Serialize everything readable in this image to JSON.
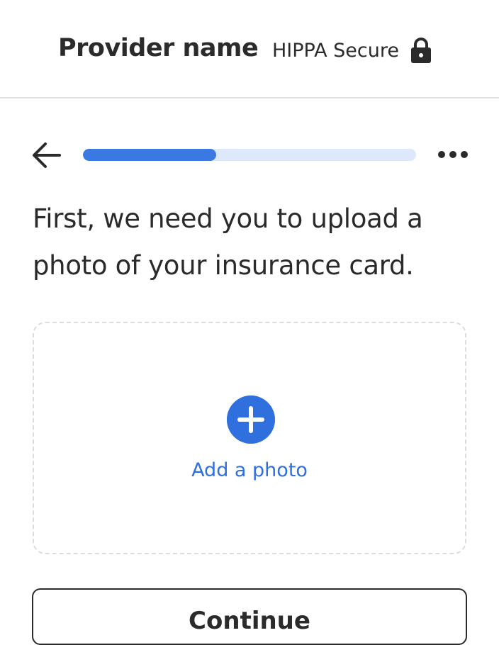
{
  "header": {
    "provider_name": "Provider name",
    "security_label": "HIPPA Secure",
    "security_icon": "lock-icon"
  },
  "nav": {
    "back_icon": "arrow-left-icon",
    "more_icon": "more-horizontal-icon",
    "progress_percent": 40
  },
  "main": {
    "prompt": "First, we need you to upload a photo of your insurance card.",
    "upload": {
      "icon": "plus-circle-icon",
      "label": "Add a photo"
    },
    "continue_label": "Continue"
  },
  "colors": {
    "accent": "#2f6fde",
    "progress_fill": "#3a79e2",
    "progress_track": "#dde9fb",
    "text": "#2a2a2a",
    "divider": "#e2e2e2",
    "dashed_border": "#dcdcdc"
  }
}
